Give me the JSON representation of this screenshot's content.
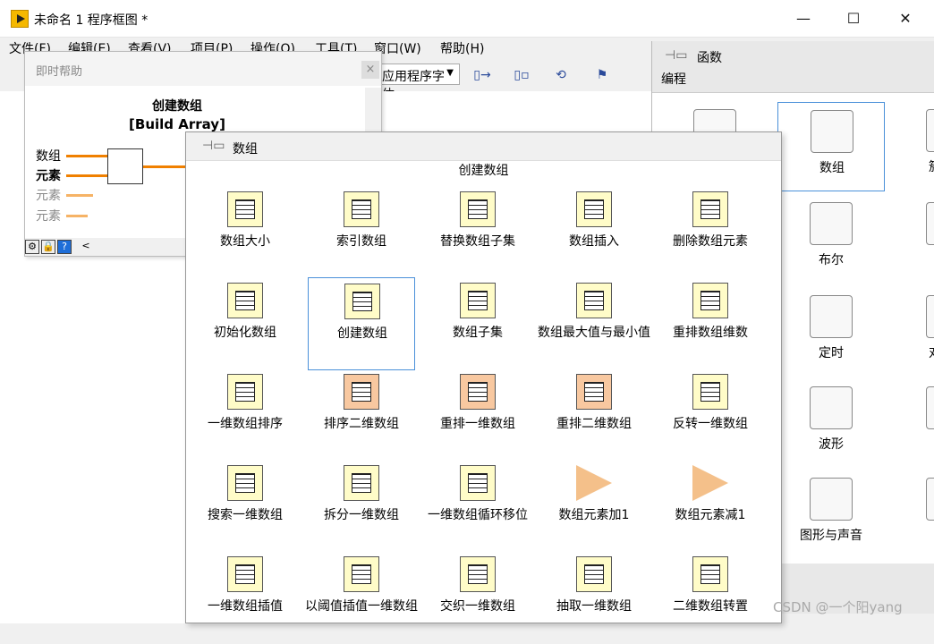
{
  "window": {
    "title": "未命名 1 程序框图 *",
    "minimize": "—",
    "maximize": "☐",
    "close": "✕"
  },
  "menu": [
    "文件(F)",
    "编辑(E)",
    "查看(V)",
    "项目(P)",
    "操作(O)",
    "工具(T)",
    "窗口(W)",
    "帮助(H)"
  ],
  "toolbar": {
    "font": "应用程序字体",
    "buttons": [
      "▯→",
      "▯▫",
      "⟲",
      "⚑"
    ]
  },
  "context_help": {
    "title": "即时帮助",
    "close": "×",
    "function_name": "创建数组",
    "function_en": "[Build Array]",
    "terminals": [
      "数组",
      "元素",
      "元素",
      "元素"
    ],
    "footer_buttons": [
      "⚙",
      "🔒",
      "?"
    ],
    "scroll_left": "<"
  },
  "functions_palette": {
    "title": "函数",
    "subtitle": "编程",
    "items": [
      {
        "label": "",
        "icon": "cluster-icon"
      },
      {
        "label": "数组",
        "icon": "array-icon"
      },
      {
        "label": "簇、类"
      },
      {
        "label": "布尔",
        "icon": "boolean-icon"
      },
      {
        "label": "字"
      },
      {
        "label": "定时",
        "icon": "timer-icon"
      },
      {
        "label": "对话框"
      },
      {
        "label": "波形",
        "icon": "waveform-icon"
      },
      {
        "label": "应用"
      },
      {
        "label": "图形与声音",
        "icon": "graphics-sound-icon"
      },
      {
        "label": "报"
      }
    ]
  },
  "array_palette": {
    "title": "数组",
    "subtitle": "创建数组",
    "items": [
      {
        "label": "数组大小",
        "style": "plain"
      },
      {
        "label": "索引数组",
        "style": "plain"
      },
      {
        "label": "替换数组子集",
        "style": "plain"
      },
      {
        "label": "数组插入",
        "style": "plain"
      },
      {
        "label": "删除数组元素",
        "style": "plain"
      },
      {
        "label": "初始化数组",
        "style": "plain"
      },
      {
        "label": "创建数组",
        "style": "plain"
      },
      {
        "label": "数组子集",
        "style": "plain"
      },
      {
        "label": "数组最大值与最小值",
        "style": "plain"
      },
      {
        "label": "重排数组维数",
        "style": "plain"
      },
      {
        "label": "一维数组排序",
        "style": "plain"
      },
      {
        "label": "排序二维数组",
        "style": "orange"
      },
      {
        "label": "重排一维数组",
        "style": "orange"
      },
      {
        "label": "重排二维数组",
        "style": "orange"
      },
      {
        "label": "反转一维数组",
        "style": "plain"
      },
      {
        "label": "搜索一维数组",
        "style": "plain"
      },
      {
        "label": "拆分一维数组",
        "style": "plain"
      },
      {
        "label": "一维数组循环移位",
        "style": "plain"
      },
      {
        "label": "数组元素加1",
        "style": "tri"
      },
      {
        "label": "数组元素减1",
        "style": "tri"
      },
      {
        "label": "一维数组插值",
        "style": "plain"
      },
      {
        "label": "以阈值插值一维数组",
        "style": "plain"
      },
      {
        "label": "交织一维数组",
        "style": "plain"
      },
      {
        "label": "抽取一维数组",
        "style": "plain"
      },
      {
        "label": "二维数组转置",
        "style": "plain"
      }
    ]
  },
  "watermark": "CSDN @一个阳yang"
}
